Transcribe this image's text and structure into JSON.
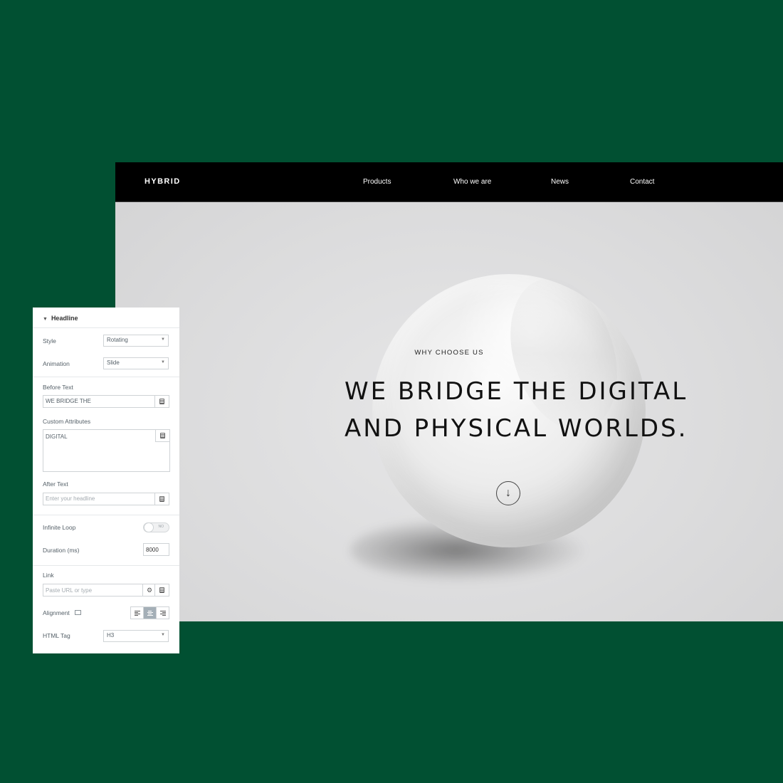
{
  "site": {
    "logo": "HYBRID",
    "nav": [
      "Products",
      "Who we are",
      "News",
      "Contact"
    ],
    "eyebrow": "WHY CHOOSE US",
    "headline_line1": "WE BRIDGE THE DIGITAL",
    "headline_line2": "AND PHYSICAL WORLDS.",
    "scroll_icon": "arrow-down-icon",
    "scroll_glyph": "↓"
  },
  "panel": {
    "section_title": "Headline",
    "style_label": "Style",
    "style_value": "Rotating",
    "animation_label": "Animation",
    "animation_value": "Slide",
    "before_text_label": "Before Text",
    "before_text_value": "WE BRIDGE THE",
    "custom_attributes_label": "Custom Attributes",
    "custom_attributes_value": "DIGITAL",
    "after_text_label": "After Text",
    "after_text_placeholder": "Enter your headline",
    "infinite_loop_label": "Infinite Loop",
    "infinite_loop_state": "NO",
    "duration_label": "Duration (ms)",
    "duration_value": "8000",
    "link_label": "Link",
    "link_placeholder": "Paste URL or type",
    "alignment_label": "Alignment",
    "alignment_selected": "center",
    "html_tag_label": "HTML Tag",
    "html_tag_value": "H3"
  },
  "colors": {
    "background": "#015032",
    "nav_bg": "#000000",
    "active_align": "#a4afb7"
  }
}
